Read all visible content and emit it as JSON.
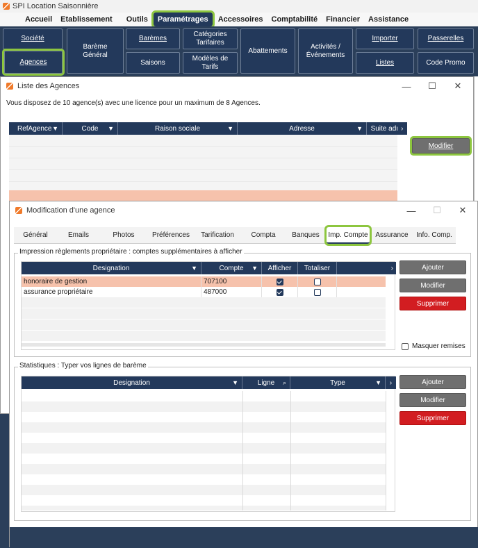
{
  "app": {
    "title": "SPI Location Saisonnière"
  },
  "menu": [
    "Accueil",
    "Etablissement",
    "Outils",
    "Paramétrages",
    "Accessoires",
    "Comptabilité",
    "Financier",
    "Assistance"
  ],
  "ribbon": {
    "societe": "Société",
    "agences": "Agences",
    "bareme_general": "Barème\nGénéral",
    "baremes": "Barèmes",
    "saisons": "Saisons",
    "categories_tarifaires": "Catégories\nTarifaires",
    "modeles_tarifs": "Modèles de\nTarifs",
    "abattements": "Abattements",
    "activites": "Activités /\nÉvénements",
    "importer": "Importer",
    "listes": "Listes",
    "passerelles": "Passerelles",
    "code_promo": "Code Promo"
  },
  "agences_window": {
    "title": "Liste des Agences",
    "license_text": "Vous disposez de 10 agence(s) avec une licence pour un maximum de 8 Agences.",
    "columns": [
      "RefAgence",
      "Code",
      "Raison sociale",
      "Adresse",
      "Suite adı"
    ],
    "modifier": "Modifier"
  },
  "modif_window": {
    "title": "Modification d'une agence",
    "tabs": [
      "Général",
      "Emails",
      "Photos",
      "Préférences",
      "Tarification",
      "Compta",
      "Banques",
      "Imp. Compte",
      "Assurance",
      "Info. Comp."
    ],
    "group1": {
      "legend": "Impression règlements propriétaire : comptes supplémentaires à afficher",
      "columns": [
        "Designation",
        "Compte",
        "Afficher",
        "Totaliser"
      ],
      "rows": [
        {
          "designation": "honoraire de gestion",
          "compte": "707100",
          "afficher": true,
          "totaliser": false
        },
        {
          "designation": "assurance propriétaire",
          "compte": "487000",
          "afficher": true,
          "totaliser": false
        }
      ],
      "ajouter": "Ajouter",
      "modifier": "Modifier",
      "supprimer": "Supprimer",
      "masquer_remises": "Masquer remises"
    },
    "group2": {
      "legend": "Statistiques : Typer vos lignes de barème",
      "columns": [
        "Designation",
        "Ligne",
        "Type"
      ],
      "ajouter": "Ajouter",
      "modifier": "Modifier",
      "supprimer": "Supprimer"
    }
  },
  "colors": {
    "navy": "#23395b",
    "highlight": "#8dc63f",
    "selected_row": "#f9c6ae",
    "danger": "#d21d21"
  }
}
